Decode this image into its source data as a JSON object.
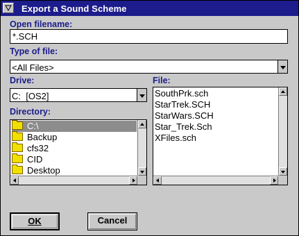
{
  "window": {
    "title": "Export a Sound Scheme"
  },
  "open_filename": {
    "label": "Open filename:",
    "value": "*.SCH"
  },
  "type_of_file": {
    "label": "Type of file:",
    "value": "<All Files>"
  },
  "drive": {
    "label": "Drive:",
    "value": "C:  [OS2]"
  },
  "directory": {
    "label": "Directory:",
    "items": [
      "C:\\",
      "Backup",
      "cfs32",
      "CID",
      "Desktop"
    ]
  },
  "file": {
    "label": "File:",
    "items": [
      "SouthPrk.sch",
      "StarTrek.SCH",
      "StarWars.SCH",
      "Star_Trek.Sch",
      "XFiles.sch"
    ]
  },
  "buttons": {
    "ok": "OK",
    "cancel": "Cancel"
  },
  "icons": [
    "system-menu-icon",
    "folder-icon",
    "dropdown-arrow-icon",
    "scroll-arrow-icon"
  ],
  "colors": {
    "titlebar": "#1c1c8c",
    "label": "#1c1c8c",
    "selection": "#8c8c8c"
  }
}
